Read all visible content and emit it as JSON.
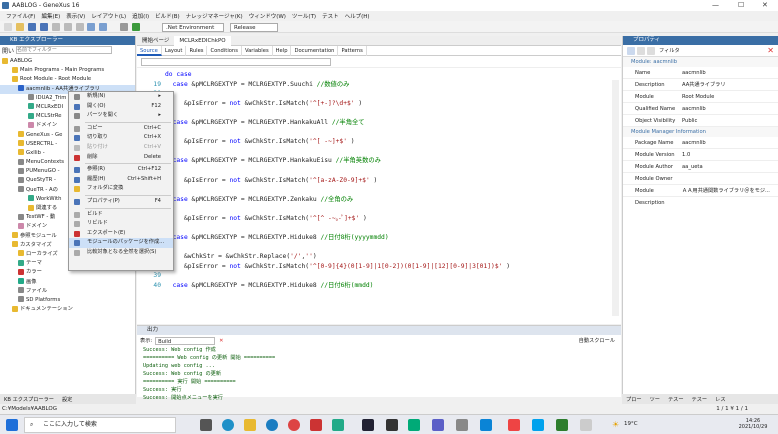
{
  "window": {
    "title": "AABLOG - GeneXus 16"
  },
  "menu": [
    "ファイル(F)",
    "編集(E)",
    "表示(V)",
    "レイアウト(L)",
    "追加(I)",
    "ビルド(B)",
    "ナレッジマネージャ(K)",
    "ウィンドウ(W)",
    "ツール(T)",
    "テスト",
    "ヘルプ(H)"
  ],
  "toolbar": {
    "environment": ".Net Environment",
    "config": "Release"
  },
  "kb": {
    "title": "KB エクスプローラー",
    "filter_label": "開い",
    "filter_placeholder": "名前でフィルター",
    "items": [
      "AABLOG",
      "Main Programs - Main Programs",
      "Root Module - Root Module",
      "aacmnlib - AA共通ライブラリ",
      "IDUA2_Trim",
      "MCLRxEDI",
      "MCLStrRe",
      "ドメイン",
      "GeneXus - Ge",
      "USERCTRL - ",
      "Gxllib - ",
      "MenuContexts",
      "PUMenuGO - ",
      "QueStyTR - ",
      "QueTR - Aの",
      "WorkWith",
      "関連する",
      "TestWF - 動",
      "ドメイン",
      "参照モジュール",
      "カスタマイズ",
      "ローカライズ",
      "テーマ",
      "カラー",
      "画像",
      "ファイル",
      "SD Platforms",
      "ドキュメンテーション"
    ]
  },
  "kb_bottom": [
    "KB エクスプローラー",
    "設定"
  ],
  "editor": {
    "tabs": [
      "開始ページ",
      "MCLRxEDIChkPO"
    ],
    "subtabs": [
      "Source",
      "Layout",
      "Rules",
      "Conditions",
      "Variables",
      "Help",
      "Documentation",
      "Patterns"
    ],
    "lines": [
      {
        "n": "",
        "t": [
          [
            "kw",
            "do case"
          ]
        ]
      },
      {
        "n": "19",
        "t": [
          [
            "kw",
            "  case "
          ],
          [
            "",
            "&pMCLRGEXTYP = MCLRGEXTYP.Suuchi "
          ],
          [
            "cm",
            "//数値のみ"
          ]
        ]
      },
      {
        "n": "20",
        "t": []
      },
      {
        "n": "21",
        "t": [
          [
            "",
            "     &pIsError = "
          ],
          [
            "kw",
            "not "
          ],
          [
            "",
            "&wChkStr.IsMatch("
          ],
          [
            "st",
            "'^[+-]?\\d+$'"
          ],
          [
            "",
            " )"
          ]
        ]
      },
      {
        "n": "22",
        "t": []
      },
      {
        "n": "23",
        "t": [
          [
            "kw",
            "  case "
          ],
          [
            "",
            "&pMCLRGEXTYP = MCLRGEXTYP.HankakuAll "
          ],
          [
            "cm",
            "//半角全て"
          ]
        ]
      },
      {
        "n": "24",
        "t": []
      },
      {
        "n": "25",
        "t": [
          [
            "",
            "     &pIsError = "
          ],
          [
            "kw",
            "not "
          ],
          [
            "",
            "&wChkStr.IsMatch("
          ],
          [
            "st",
            "'^[ -~]+$'"
          ],
          [
            "",
            " )"
          ]
        ]
      },
      {
        "n": "26",
        "t": []
      },
      {
        "n": "27",
        "t": [
          [
            "kw",
            "  case "
          ],
          [
            "",
            "&pMCLRGEXTYP = MCLRGEXTYP.HankakuEisu "
          ],
          [
            "cm",
            "//半角英数のみ"
          ]
        ]
      },
      {
        "n": "28",
        "t": []
      },
      {
        "n": "29",
        "t": [
          [
            "",
            "     &pIsError = "
          ],
          [
            "kw",
            "not "
          ],
          [
            "",
            "&wChkStr.IsMatch("
          ],
          [
            "st",
            "'^[a-zA-Z0-9]+$'"
          ],
          [
            "",
            " )"
          ]
        ]
      },
      {
        "n": "30",
        "t": []
      },
      {
        "n": "31",
        "t": [
          [
            "kw",
            "  case "
          ],
          [
            "",
            "&pMCLRGEXTYP = MCLRGEXTYP.Zenkaku "
          ],
          [
            "cm",
            "//全角のみ"
          ]
        ]
      },
      {
        "n": "32",
        "t": []
      },
      {
        "n": "33",
        "t": [
          [
            "",
            "     &pIsError = "
          ],
          [
            "kw",
            "not "
          ],
          [
            "",
            "&wChkStr.IsMatch("
          ],
          [
            "st",
            "'^[^ -~｡-ﾟ]+$'"
          ],
          [
            "",
            " )"
          ]
        ]
      },
      {
        "n": "34",
        "t": []
      },
      {
        "n": "35",
        "t": [
          [
            "kw",
            "  case "
          ],
          [
            "",
            "&pMCLRGEXTYP = MCLRGEXTYP.Hiduke8 "
          ],
          [
            "cm",
            "//日付8桁(yyyymmdd)"
          ]
        ]
      },
      {
        "n": "36",
        "t": []
      },
      {
        "n": "37",
        "t": [
          [
            "",
            "     &wChkStr = &wChkStr.Replace("
          ],
          [
            "st",
            "'/'"
          ],
          [
            ",",
            ""
          ],
          [
            "st",
            "''"
          ],
          [
            ")",
            ""
          ]
        ]
      },
      {
        "n": "38",
        "t": [
          [
            "",
            "     &pIsError = "
          ],
          [
            "kw",
            "not "
          ],
          [
            "",
            "&wChkStr.IsMatch("
          ],
          [
            "st",
            "'^[0-9]{4}(0[1-9]|1[0-2])(0[1-9]|[12][0-9]|3[01])$'"
          ],
          [
            "",
            " )"
          ]
        ]
      },
      {
        "n": "39",
        "t": []
      },
      {
        "n": "40",
        "t": [
          [
            "kw",
            "  case "
          ],
          [
            "",
            "&pMCLRGEXTYP = MCLRGEXTYP.Hiduke8 "
          ],
          [
            "cm",
            "//日付6桁(mmdd)"
          ]
        ]
      }
    ]
  },
  "context_menu": [
    {
      "label": "新規(N)",
      "sc": "▸"
    },
    {
      "label": "開く(O)",
      "sc": "F12"
    },
    {
      "label": "パーツを開く",
      "sc": "▸"
    },
    {
      "sep": true
    },
    {
      "label": "コピー",
      "sc": "Ctrl+C"
    },
    {
      "label": "切り取り",
      "sc": "Ctrl+X"
    },
    {
      "label": "貼り付け",
      "sc": "Ctrl+V"
    },
    {
      "label": "削除",
      "sc": "Delete"
    },
    {
      "sep": true
    },
    {
      "label": "参照(R)",
      "sc": "Ctrl+F12"
    },
    {
      "label": "履歴(H)",
      "sc": "Ctrl+Shift+H"
    },
    {
      "label": "フォルダに変換",
      "sc": ""
    },
    {
      "sep": true
    },
    {
      "label": "プロパティ(P)",
      "sc": "F4"
    },
    {
      "sep": true
    },
    {
      "label": "ビルド",
      "sc": ""
    },
    {
      "label": "リビルド",
      "sc": ""
    },
    {
      "label": "エクスポート(E)",
      "sc": ""
    },
    {
      "label": "モジュールのパッケージを作成...",
      "sc": ""
    },
    {
      "label": "比較対象となる全然を選択(S)",
      "sc": ""
    }
  ],
  "properties": {
    "title": "プロパティ",
    "filter_label": "フィルタ",
    "object": "Module: aacmnlib",
    "rows": [
      [
        "Name",
        "aacmnlib"
      ],
      [
        "Description",
        "AA共通ライブラリ"
      ],
      [
        "Module",
        "Root Module"
      ],
      [
        "Qualified Name",
        "aacmnlib"
      ],
      [
        "Object Visibility",
        "Public"
      ]
    ],
    "section2": "Module Manager Information",
    "rows2": [
      [
        "Package Name",
        "aacmnlib"
      ],
      [
        "Module Version",
        "1.0"
      ],
      [
        "Module Author",
        "aa_ueta"
      ],
      [
        "Module Owner",
        ""
      ],
      [
        "Module Description",
        "ＡＡ用共通関数ライブラリ＠をモジ..."
      ]
    ],
    "bottom_tabs": [
      "プロー",
      "ツー",
      "テスー",
      "テスー",
      "レス"
    ]
  },
  "output": {
    "title": "出力",
    "show_label": "表示:",
    "source": "Build",
    "scroll_btn": "自動スクロール",
    "lines": [
      "Success: Web config 作成",
      "========== Web config の更新 開始 ==========",
      "Updating web config ...",
      "Success: Web config の更新",
      "========== 実行 開始 ==========",
      "Success: 実行",
      "Success: 開始点メニューを実行"
    ]
  },
  "status": {
    "path": "C:¥Models¥AABLOG",
    "right": "1 / 1 ¥ 1 / 1"
  },
  "taskbar": {
    "search_placeholder": "ここに入力して検索",
    "weather": "19°C",
    "time": "14:26",
    "date": "2021/10/29"
  }
}
